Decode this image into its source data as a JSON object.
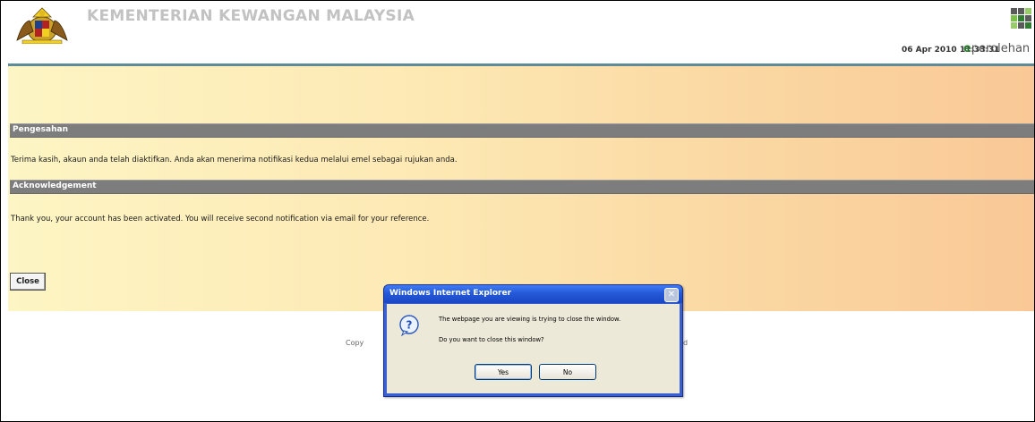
{
  "header": {
    "ministry_title": "KEMENTERIAN KEWANGAN MALAYSIA",
    "datetime": "06 Apr 2010 11:33:31",
    "logo_prefix": "e",
    "logo_text": "perolehan"
  },
  "sections": [
    {
      "heading": "Pengesahan",
      "message": "Terima kasih, akaun anda telah diaktifkan. Anda akan menerima notifikasi kedua melalui emel sebagai rujukan anda."
    },
    {
      "heading": "Acknowledgement",
      "message": "Thank you, your account has been activated. You will receive second notification via email for your reference."
    }
  ],
  "close_button_label": "Close",
  "footer": {
    "left_partial": "Copy",
    "right_partial": "d"
  },
  "dialog": {
    "title": "Windows Internet Explorer",
    "close_glyph": "✕",
    "icon": "question-icon",
    "line1": "The webpage you are viewing is trying to close the window.",
    "line2": "Do you want to close this window?",
    "yes_label": "Yes",
    "no_label": "No"
  },
  "colors": {
    "panel_accent": "#5f8a98",
    "section_bar": "#7d7d7d",
    "dialog_title": "#2459d8",
    "dialog_body": "#ece9d8"
  }
}
